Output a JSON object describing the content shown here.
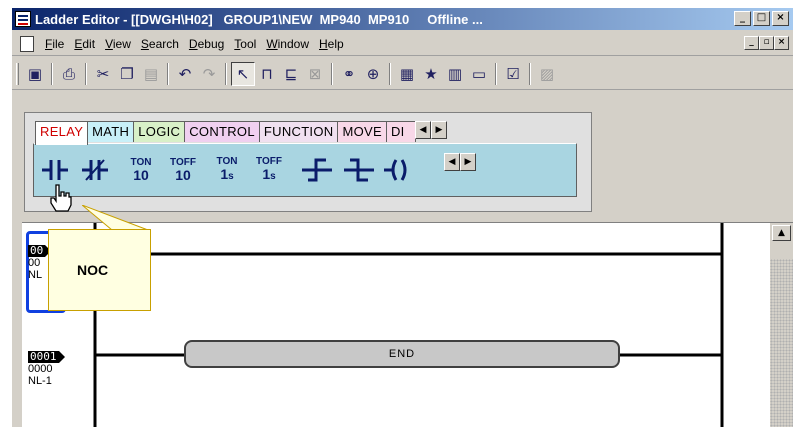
{
  "window": {
    "title": "Ladder Editor - [[DWGH\\H02]   GROUP1\\NEW  MP940  MP910     Offline ...",
    "title_buttons": [
      "_",
      "□",
      "×"
    ]
  },
  "menubar": {
    "items": [
      {
        "key": "F",
        "rest": "ile"
      },
      {
        "key": "E",
        "rest": "dit"
      },
      {
        "key": "V",
        "rest": "iew"
      },
      {
        "key": "S",
        "rest": "earch"
      },
      {
        "key": "D",
        "rest": "ebug"
      },
      {
        "key": "T",
        "rest": "ool"
      },
      {
        "key": "W",
        "rest": "indow"
      },
      {
        "key": "H",
        "rest": "elp"
      }
    ],
    "mdi_buttons": [
      "_",
      "▫",
      "×"
    ]
  },
  "toolbar": {
    "icons": [
      "save-icon",
      "print-icon",
      "cut-icon",
      "copy-icon",
      "paste-icon",
      "undo-icon",
      "redo-icon",
      "select-icon",
      "coil-insert-icon",
      "contact-insert-icon",
      "delete-element-icon",
      "binoculars-find-icon",
      "zoom-find-icon",
      "register-list-icon",
      "favorite-icon",
      "table-icon",
      "window-icon",
      "check-icon",
      "help-icon"
    ]
  },
  "palette": {
    "tabs": [
      "RELAY",
      "MATH",
      "LOGIC",
      "CONTROL",
      "FUNCTION",
      "MOVE",
      "DI"
    ],
    "tools": [
      {
        "name": "noc-contact",
        "top": "",
        "bot": ""
      },
      {
        "name": "ncc-contact",
        "top": "",
        "bot": ""
      },
      {
        "name": "ton-10ms",
        "top": "TON",
        "bot": "10",
        "suffix": ""
      },
      {
        "name": "toff-10ms",
        "top": "TOFF",
        "bot": "10",
        "suffix": ""
      },
      {
        "name": "ton-1s",
        "top": "TON",
        "bot": "1",
        "suffix": "s"
      },
      {
        "name": "toff-1s",
        "top": "TOFF",
        "bot": "1",
        "suffix": "s"
      }
    ]
  },
  "ladder": {
    "rungs": [
      {
        "number": "00",
        "step": "00",
        "label": "NL"
      },
      {
        "number": "0001",
        "step": "0000",
        "label": "NL-1"
      }
    ],
    "end_label": "END"
  },
  "tooltip": {
    "text": "NOC"
  },
  "colors": {
    "title_gradient_start": "#0a246a",
    "active_tab_text": "#d00000",
    "palette_bg": "#a9d5e1",
    "tooltip_bg": "#ffffe1",
    "rung_selection": "#1040e0"
  }
}
